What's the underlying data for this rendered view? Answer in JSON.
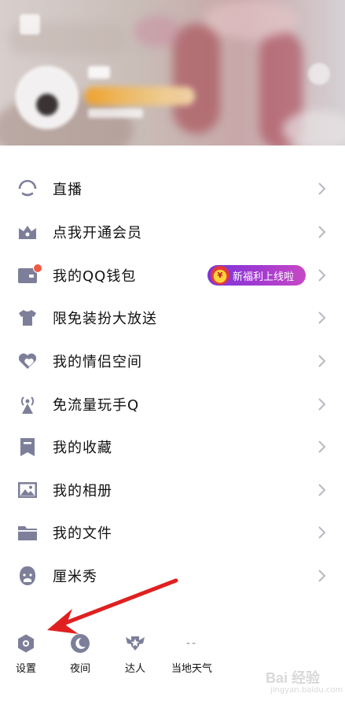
{
  "menu": {
    "items": [
      {
        "label": "直播",
        "icon": "live-icon"
      },
      {
        "label": "点我开通会员",
        "icon": "crown-icon"
      },
      {
        "label": "我的QQ钱包",
        "icon": "wallet-icon",
        "has_dot": true,
        "promo": "新福利上线啦"
      },
      {
        "label": "限免装扮大放送",
        "icon": "shirt-icon"
      },
      {
        "label": "我的情侣空间",
        "icon": "couple-heart-icon"
      },
      {
        "label": "免流量玩手Q",
        "icon": "signal-tower-icon"
      },
      {
        "label": "我的收藏",
        "icon": "bookmark-icon"
      },
      {
        "label": "我的相册",
        "icon": "photo-icon"
      },
      {
        "label": "我的文件",
        "icon": "folder-icon"
      },
      {
        "label": "厘米秀",
        "icon": "cmshow-face-icon"
      }
    ]
  },
  "bottom_bar": {
    "settings": {
      "label": "设置",
      "icon": "hexagon-settings-icon"
    },
    "night": {
      "label": "夜间",
      "icon": "moon-icon"
    },
    "expert": {
      "label": "达人",
      "icon": "winged-badge-icon"
    },
    "weather": {
      "label": "当地天气",
      "value": "--"
    }
  },
  "colors": {
    "icon_gray": "#7d7f9a",
    "chevron": "#b8b8c0",
    "promo_start": "#7b35d6",
    "promo_end": "#c749c4",
    "notification_dot": "#f05a43",
    "annotation_arrow": "#e02020"
  },
  "watermark": {
    "brand": "Bai 经验",
    "sub": "jingyan.baidu.com"
  }
}
